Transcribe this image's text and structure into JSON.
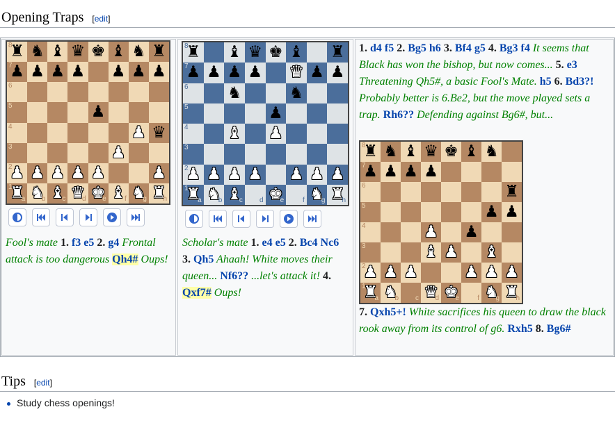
{
  "sections": {
    "traps": {
      "title": "Opening Traps",
      "edit": "edit"
    },
    "tips": {
      "title": "Tips",
      "edit": "edit",
      "items": [
        "Study chess openings!"
      ]
    }
  },
  "colors": {
    "light_brown": "#f0d9b5",
    "dark_brown": "#b58863",
    "light_blue": "#dee3e6",
    "dark_blue": "#4b6e9b",
    "move_link": "#0645ad",
    "comment": "#008000",
    "highlight": "#ffffa8"
  },
  "files": [
    "a",
    "b",
    "c",
    "d",
    "e",
    "f",
    "g",
    "h"
  ],
  "ranks": [
    "8",
    "7",
    "6",
    "5",
    "4",
    "3",
    "2",
    "1"
  ],
  "controls": [
    "flip-board-icon",
    "first-move-icon",
    "previous-move-icon",
    "next-move-icon",
    "play-icon",
    "last-move-icon"
  ],
  "boards": {
    "fools": {
      "theme": "brown",
      "rows": [
        "rnbqkbnr",
        "pppp.ppp",
        "........",
        "....p...",
        "......Pq",
        ".....P..",
        "PPPPP..P",
        "RNBQKBNR"
      ]
    },
    "scholars": {
      "theme": "blue",
      "rows": [
        "r.bqkb.r",
        "pppp.Qpp",
        "..n..n..",
        "....p...",
        "..B.P...",
        "........",
        "PPPP.PPP",
        "RNB.K.NR"
      ]
    },
    "bishop": {
      "theme": "brown",
      "rows": [
        "rnbqkbn.",
        "pppp....",
        ".......r",
        "......pp",
        "...P.p..",
        "...BP.B.",
        "PPP..PPP",
        "RN.QK.NR"
      ]
    }
  },
  "captions": {
    "fools": [
      {
        "t": "Fool's mate ",
        "c": "i"
      },
      {
        "t": "1. ",
        "c": "n"
      },
      {
        "t": "f3",
        "c": "m"
      },
      {
        "t": " ",
        "c": "i"
      },
      {
        "t": "e5",
        "c": "m"
      },
      {
        "t": " ",
        "c": "i"
      },
      {
        "t": "2. ",
        "c": "n"
      },
      {
        "t": "g4",
        "c": "m"
      },
      {
        "t": " Frontal attack is too dangerous ",
        "c": "i"
      },
      {
        "t": "Qh4#",
        "c": "mh"
      },
      {
        "t": " Oups!",
        "c": "i"
      }
    ],
    "scholars": [
      {
        "t": "Scholar's mate ",
        "c": "i"
      },
      {
        "t": "1. ",
        "c": "n"
      },
      {
        "t": "e4",
        "c": "m"
      },
      {
        "t": " ",
        "c": "i"
      },
      {
        "t": "e5",
        "c": "m"
      },
      {
        "t": " ",
        "c": "i"
      },
      {
        "t": "2. ",
        "c": "n"
      },
      {
        "t": "Bc4",
        "c": "m"
      },
      {
        "t": " ",
        "c": "i"
      },
      {
        "t": "Nc6",
        "c": "m"
      },
      {
        "t": " ",
        "c": "i"
      },
      {
        "t": "3. ",
        "c": "n"
      },
      {
        "t": "Qh5",
        "c": "m"
      },
      {
        "t": " Ahaah! White moves their queen... ",
        "c": "i"
      },
      {
        "t": "Nf6??",
        "c": "m"
      },
      {
        "t": " ...let's attack it! ",
        "c": "i"
      },
      {
        "t": "4. ",
        "c": "n"
      },
      {
        "t": "Qxf7#",
        "c": "mh"
      },
      {
        "t": " Oups!",
        "c": "i"
      }
    ],
    "bishop_top": [
      {
        "t": "1. ",
        "c": "n"
      },
      {
        "t": "d4",
        "c": "m"
      },
      {
        "t": " ",
        "c": "i"
      },
      {
        "t": "f5",
        "c": "m"
      },
      {
        "t": " ",
        "c": "i"
      },
      {
        "t": "2. ",
        "c": "n"
      },
      {
        "t": "Bg5",
        "c": "m"
      },
      {
        "t": " ",
        "c": "i"
      },
      {
        "t": "h6",
        "c": "m"
      },
      {
        "t": " ",
        "c": "i"
      },
      {
        "t": "3. ",
        "c": "n"
      },
      {
        "t": "Bf4",
        "c": "m"
      },
      {
        "t": " ",
        "c": "i"
      },
      {
        "t": "g5",
        "c": "m"
      },
      {
        "t": " ",
        "c": "i"
      },
      {
        "t": "4. ",
        "c": "n"
      },
      {
        "t": "Bg3",
        "c": "m"
      },
      {
        "t": " ",
        "c": "i"
      },
      {
        "t": "f4",
        "c": "m"
      },
      {
        "t": " It seems that Black has won the bishop, but now comes... ",
        "c": "i"
      },
      {
        "t": "5. ",
        "c": "n"
      },
      {
        "t": "e3",
        "c": "m"
      },
      {
        "t": " Threatening Qh5#, a basic Fool's Mate. ",
        "c": "i"
      },
      {
        "t": "h5",
        "c": "m"
      },
      {
        "t": " ",
        "c": "i"
      },
      {
        "t": "6. ",
        "c": "n"
      },
      {
        "t": "Bd3?!",
        "c": "m"
      },
      {
        "t": " Probably better is 6.Be2, but the move played sets a trap. ",
        "c": "i"
      },
      {
        "t": "Rh6??",
        "c": "m"
      },
      {
        "t": " Defending against Bg6#, but...",
        "c": "i"
      }
    ],
    "bishop_bottom": [
      {
        "t": "7. ",
        "c": "n"
      },
      {
        "t": "Qxh5+!",
        "c": "m"
      },
      {
        "t": " White sacrifices his queen to draw the black rook away from its control of g6. ",
        "c": "i"
      },
      {
        "t": "Rxh5",
        "c": "m"
      },
      {
        "t": " ",
        "c": "i"
      },
      {
        "t": "8. ",
        "c": "n"
      },
      {
        "t": "Bg6#",
        "c": "m"
      }
    ]
  }
}
